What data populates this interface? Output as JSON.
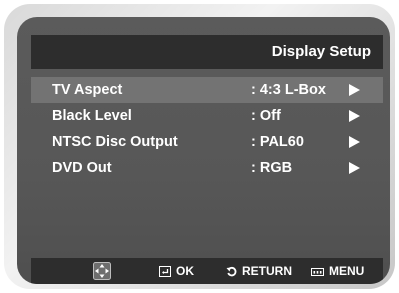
{
  "header": {
    "title": "Display Setup"
  },
  "menu": {
    "items": [
      {
        "label": "TV Aspect",
        "value": ": 4:3 L-Box",
        "selected": true
      },
      {
        "label": "Black Level",
        "value": ": Off",
        "selected": false
      },
      {
        "label": "NTSC Disc Output",
        "value": ": PAL60",
        "selected": false
      },
      {
        "label": "DVD Out",
        "value": ": RGB",
        "selected": false
      }
    ]
  },
  "footer": {
    "navigate_icon": "dpad-icon",
    "ok_icon": "enter-icon",
    "ok_label": "OK",
    "return_icon": "return-icon",
    "return_label": "RETURN",
    "menu_icon": "menu-icon",
    "menu_label": "MENU"
  },
  "colors": {
    "screen_bg": "#575757",
    "bar_bg": "#2d2d2d",
    "selected_row": "#737373",
    "text": "#ffffff"
  }
}
